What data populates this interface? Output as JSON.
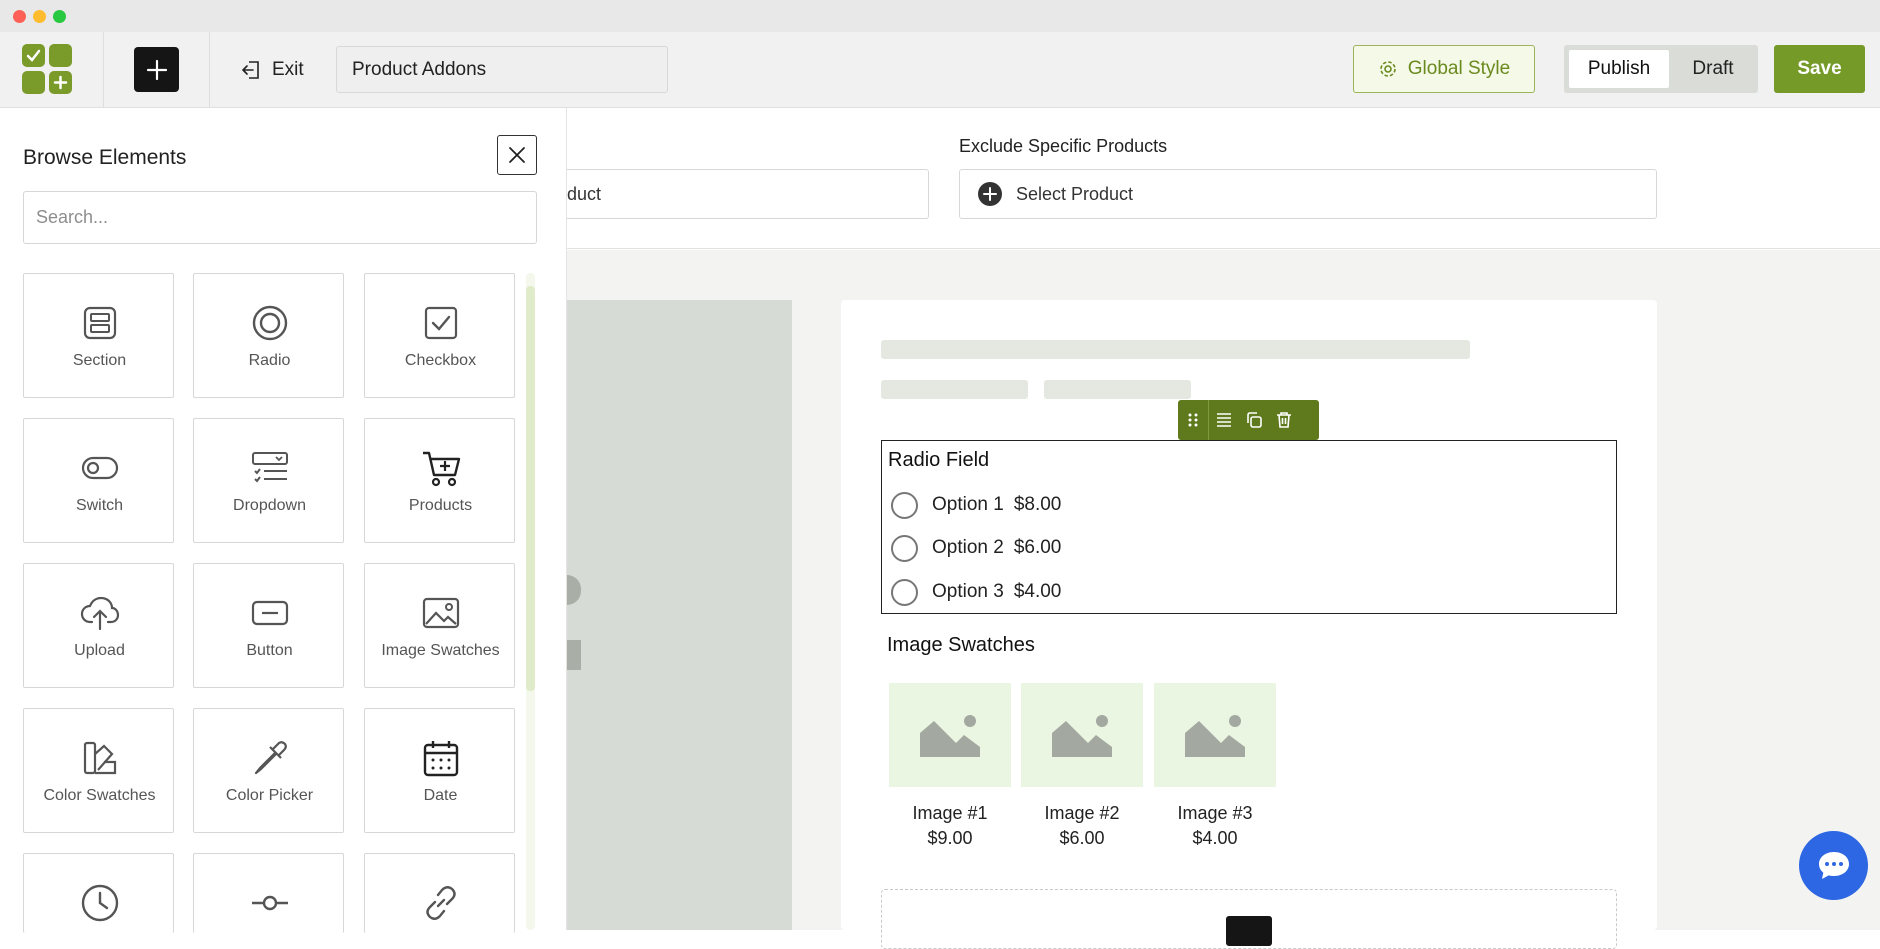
{
  "header": {
    "exit_label": "Exit",
    "page_title_value": "Product Addons",
    "global_style_label": "Global Style",
    "publish_label": "Publish",
    "draft_label": "Draft",
    "save_label": "Save"
  },
  "filters": {
    "include_placeholder_fragment": "duct",
    "exclude_label": "Exclude Specific Products",
    "exclude_placeholder": "Select Product"
  },
  "panel": {
    "title": "Browse Elements",
    "search_placeholder": "Search...",
    "elements": [
      {
        "label": "Section",
        "icon": "section-icon"
      },
      {
        "label": "Radio",
        "icon": "radio-icon"
      },
      {
        "label": "Checkbox",
        "icon": "checkbox-icon"
      },
      {
        "label": "Switch",
        "icon": "switch-icon"
      },
      {
        "label": "Dropdown",
        "icon": "dropdown-icon"
      },
      {
        "label": "Products",
        "icon": "cart-icon"
      },
      {
        "label": "Upload",
        "icon": "upload-icon"
      },
      {
        "label": "Button",
        "icon": "button-icon"
      },
      {
        "label": "Image Swatches",
        "icon": "image-icon"
      },
      {
        "label": "Color Swatches",
        "icon": "color-swatches-icon"
      },
      {
        "label": "Color Picker",
        "icon": "color-picker-icon"
      },
      {
        "label": "Date",
        "icon": "calendar-icon"
      },
      {
        "label": "",
        "icon": "clock-icon"
      },
      {
        "label": "",
        "icon": "slider-icon"
      },
      {
        "label": "",
        "icon": "link-icon"
      }
    ]
  },
  "form": {
    "radio_field": {
      "title": "Radio Field",
      "options": [
        {
          "label": "Option 1",
          "price": "$8.00"
        },
        {
          "label": "Option 2",
          "price": "$6.00"
        },
        {
          "label": "Option 3",
          "price": "$4.00"
        }
      ]
    },
    "image_swatches": {
      "title": "Image Swatches",
      "items": [
        {
          "label": "Image #1",
          "price": "$9.00"
        },
        {
          "label": "Image #2",
          "price": "$6.00"
        },
        {
          "label": "Image #3",
          "price": "$4.00"
        }
      ]
    }
  },
  "colors": {
    "accent": "#759a28",
    "toolbar": "#5e7a1c",
    "chat": "#2d67e3"
  }
}
